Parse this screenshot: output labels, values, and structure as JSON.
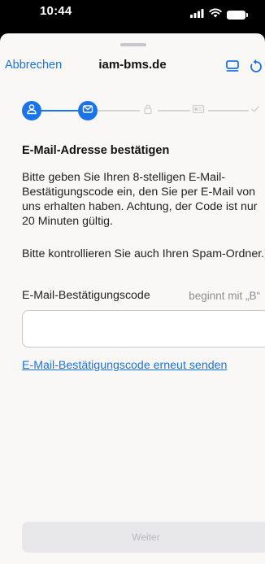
{
  "status_bar": {
    "time": "10:44",
    "icons": [
      "cellular-signal-icon",
      "wifi-icon",
      "battery-icon"
    ]
  },
  "nav": {
    "cancel_label": "Abbrechen",
    "title": "iam-bms.de",
    "right_icons": [
      "display-icon",
      "refresh-icon"
    ]
  },
  "stepper": {
    "steps": [
      {
        "icon": "person-icon",
        "state": "done"
      },
      {
        "icon": "mail-icon",
        "state": "current"
      },
      {
        "icon": "lock-icon",
        "state": "pending"
      },
      {
        "icon": "id-card-icon",
        "state": "pending"
      },
      {
        "icon": "check-icon",
        "state": "pending"
      }
    ],
    "accent": "#1a73e8",
    "inactive_color": "#d6d6d9"
  },
  "main": {
    "heading": "E-Mail-Adresse bestätigen",
    "paragraph1": "Bitte geben Sie Ihren 8-stelligen E-Mail-Bestätigungscode ein, den Sie per E-Mail von uns erhalten haben. Achtung, der Code ist nur 20 Minuten gültig.",
    "paragraph2": "Bitte kontrollieren Sie auch Ihren Spam-Ordner.",
    "field_label": "E-Mail-Bestätigungscode",
    "field_hint": "beginnt mit „B“",
    "field_value": "",
    "resend_link": "E-Mail-Bestätigungscode erneut senden",
    "next_button": "Weiter"
  }
}
